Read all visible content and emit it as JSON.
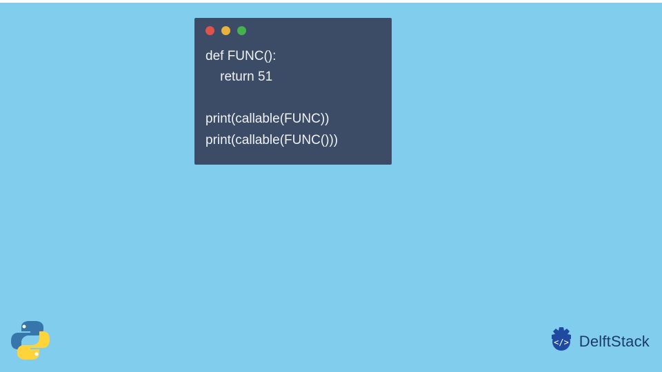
{
  "code": {
    "lines": [
      "def FUNC():",
      "    return 51",
      "",
      "print(callable(FUNC))",
      "print(callable(FUNC()))"
    ]
  },
  "traffic_lights": {
    "red": "#e0524d",
    "yellow": "#e7b23d",
    "green": "#44b24e"
  },
  "branding": {
    "delftstack_label": "DelftStack"
  },
  "colors": {
    "background": "#80cdee",
    "card": "#3d4c66",
    "code_text": "#eef1f6",
    "brand_text": "#1a3a6a"
  }
}
